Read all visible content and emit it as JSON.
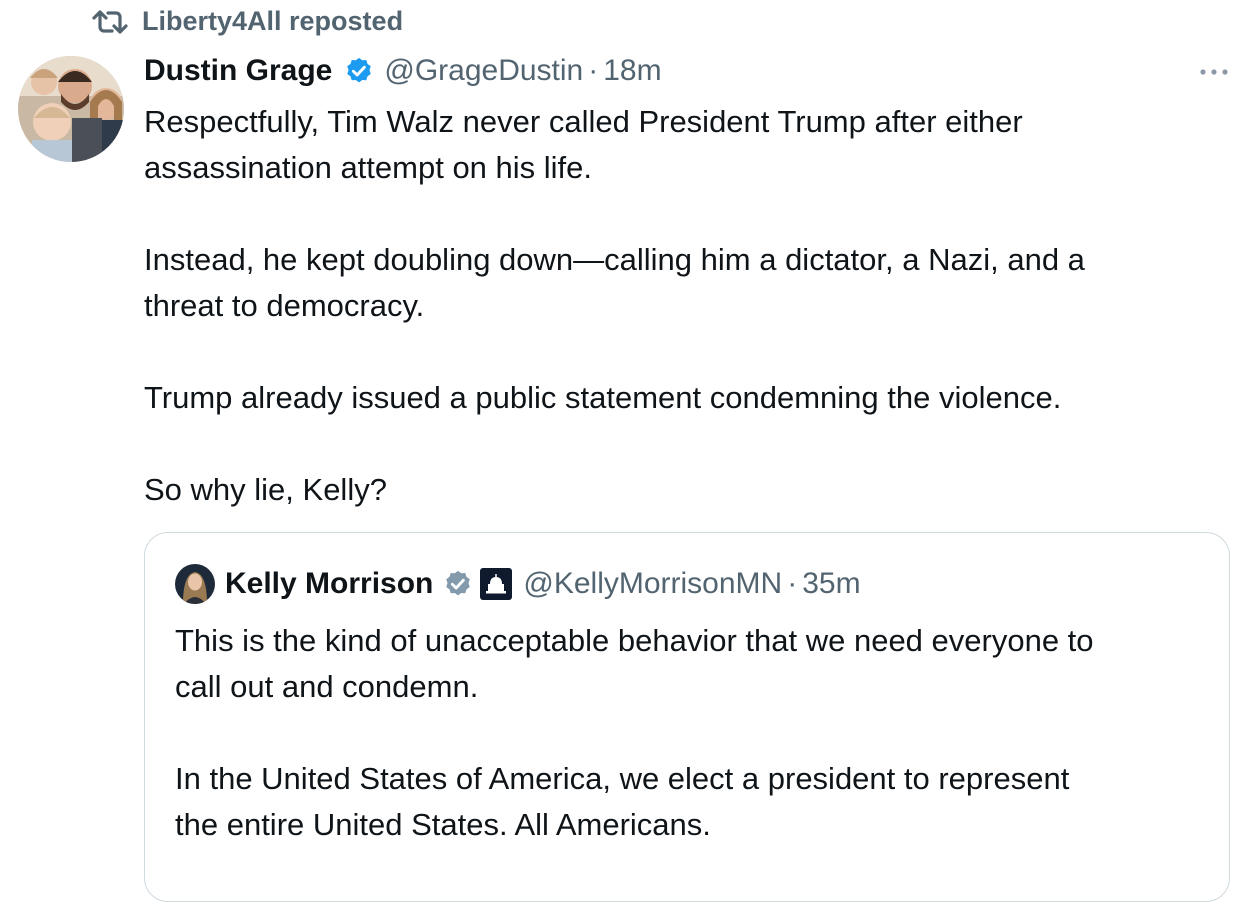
{
  "repost": {
    "icon": "repost-icon",
    "text": "Liberty4All reposted"
  },
  "tweet": {
    "author_name": "Dustin Grage",
    "handle": "@GrageDustin",
    "separator": "·",
    "time": "18m",
    "text": "Respectfully, Tim Walz never called President Trump after either\nassassination attempt on his life.\n\nInstead, he kept doubling down—calling him a dictator, a Nazi, and a\nthreat to democracy.\n\nTrump already issued a public statement condemning the violence.\n\nSo why lie, Kelly?",
    "verified_color": "#1d9bf0"
  },
  "quote": {
    "author_name": "Kelly Morrison",
    "handle": "@KellyMorrisonMN",
    "separator": "·",
    "time": "35m",
    "text": "This is the kind of unacceptable behavior that we need everyone to\ncall out and condemn.\n\nIn the United States of America, we elect a president to represent\nthe entire United States. All Americans.",
    "verified_color": "#829aab"
  },
  "colors": {
    "text_primary": "#0f1419",
    "text_secondary": "#536471",
    "border": "#cfd9de"
  }
}
